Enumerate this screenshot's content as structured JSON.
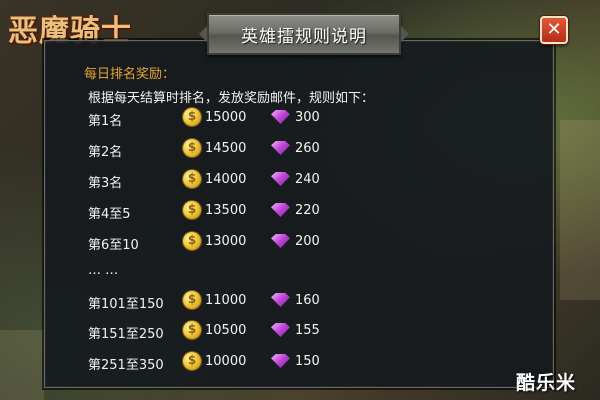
{
  "logo": "恶魔骑士",
  "dialog": {
    "title": "英雄擂规则说明",
    "close_label": "✕",
    "section_title": "每日排名奖励：",
    "intro": "根据每天结算时排名，发放奖励邮件，规则如下：",
    "ellipsis": "… …",
    "rewards_top": [
      {
        "rank": "第1名",
        "gold": "15000",
        "gems": "300"
      },
      {
        "rank": "第2名",
        "gold": "14500",
        "gems": "260"
      },
      {
        "rank": "第3名",
        "gold": "14000",
        "gems": "240"
      },
      {
        "rank": "第4至5",
        "gold": "13500",
        "gems": "220"
      },
      {
        "rank": "第6至10",
        "gold": "13000",
        "gems": "200"
      }
    ],
    "rewards_bottom": [
      {
        "rank": "第101至150",
        "gold": "11000",
        "gems": "160"
      },
      {
        "rank": "第151至250",
        "gold": "10500",
        "gems": "155"
      },
      {
        "rank": "第251至350",
        "gold": "10000",
        "gems": "150"
      }
    ]
  },
  "watermark": "酷乐米",
  "icons": {
    "gold": "gold-coin-icon",
    "gem": "purple-gem-icon"
  },
  "colors": {
    "section_title": "#e7a52e",
    "close_button": "#d2462a"
  }
}
